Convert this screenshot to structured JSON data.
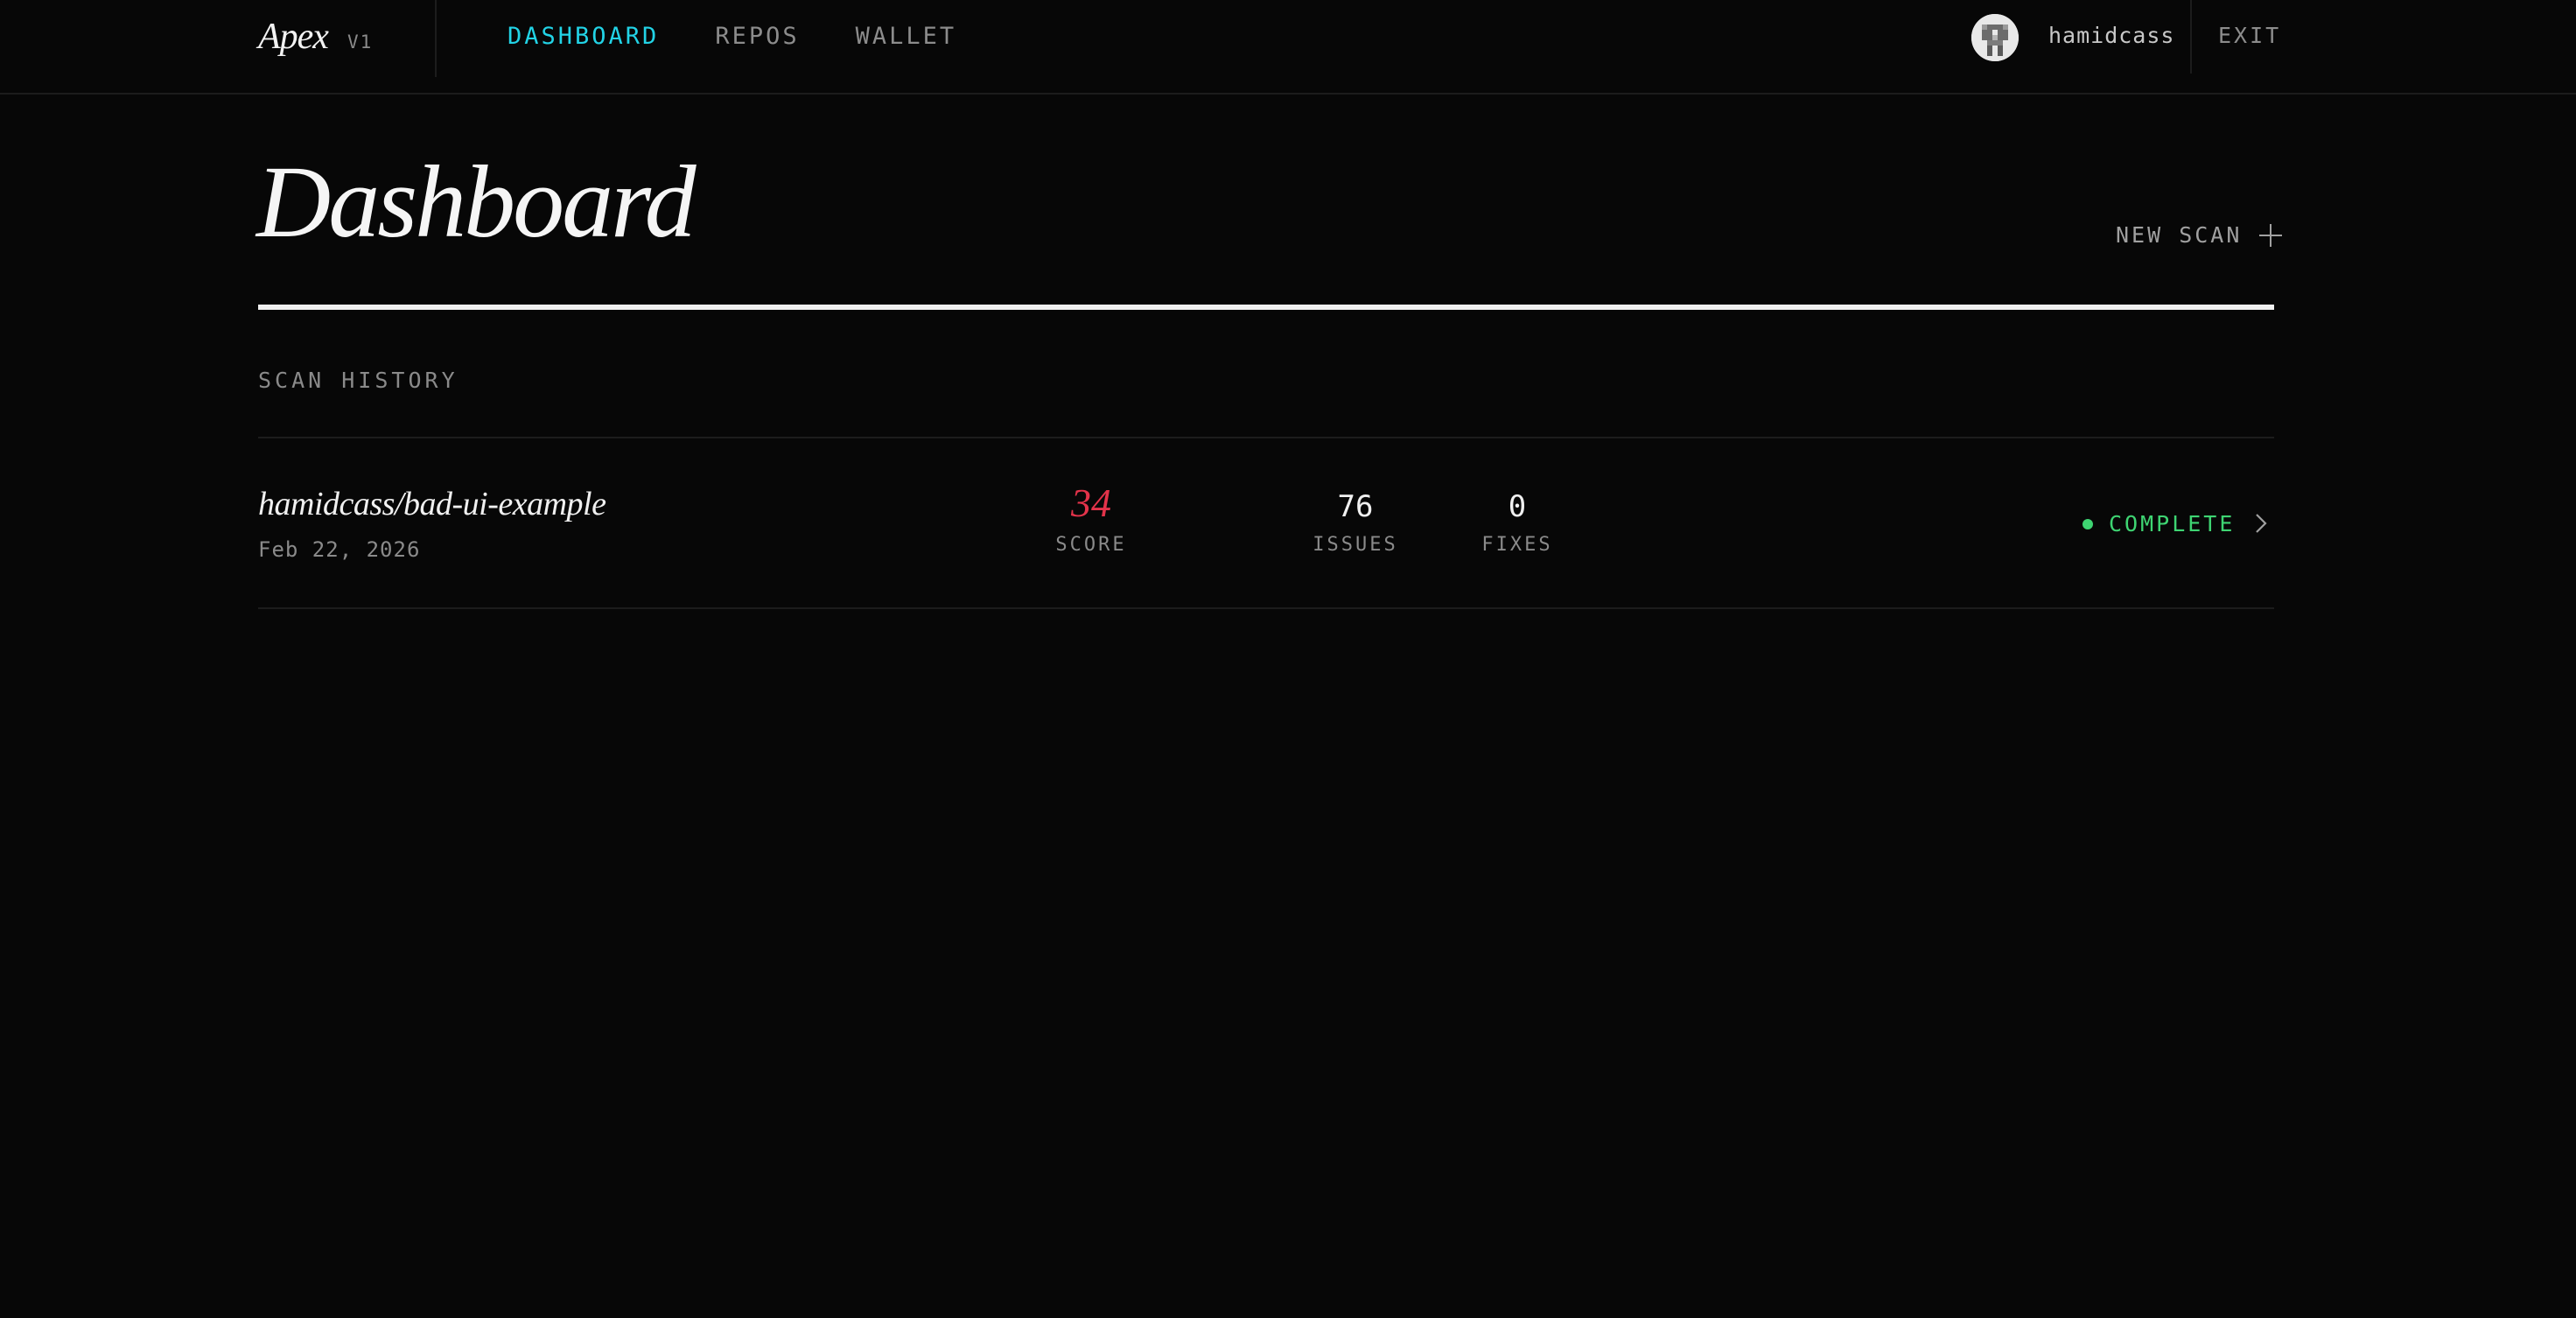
{
  "app": {
    "name": "Apex",
    "version": "V1"
  },
  "nav": {
    "items": [
      {
        "label": "DASHBOARD",
        "active": true
      },
      {
        "label": "REPOS",
        "active": false
      },
      {
        "label": "WALLET",
        "active": false
      }
    ]
  },
  "user": {
    "username": "hamidcass",
    "exit_label": "EXIT"
  },
  "page": {
    "title": "Dashboard",
    "new_scan_label": "NEW SCAN",
    "section_label": "SCAN HISTORY"
  },
  "scans": [
    {
      "repo": "hamidcass/bad-ui-example",
      "date": "Feb 22, 2026",
      "score": "34",
      "score_label": "SCORE",
      "issues": "76",
      "issues_label": "ISSUES",
      "fixes": "0",
      "fixes_label": "FIXES",
      "status": "COMPLETE"
    }
  ],
  "colors": {
    "accent": "#22d3e6",
    "score": "#e3334a",
    "status_complete": "#3ed472",
    "background": "#070707"
  },
  "icons": {
    "new_scan": "plus-icon",
    "row_open": "chevron-right-icon",
    "status": "status-dot-icon"
  }
}
